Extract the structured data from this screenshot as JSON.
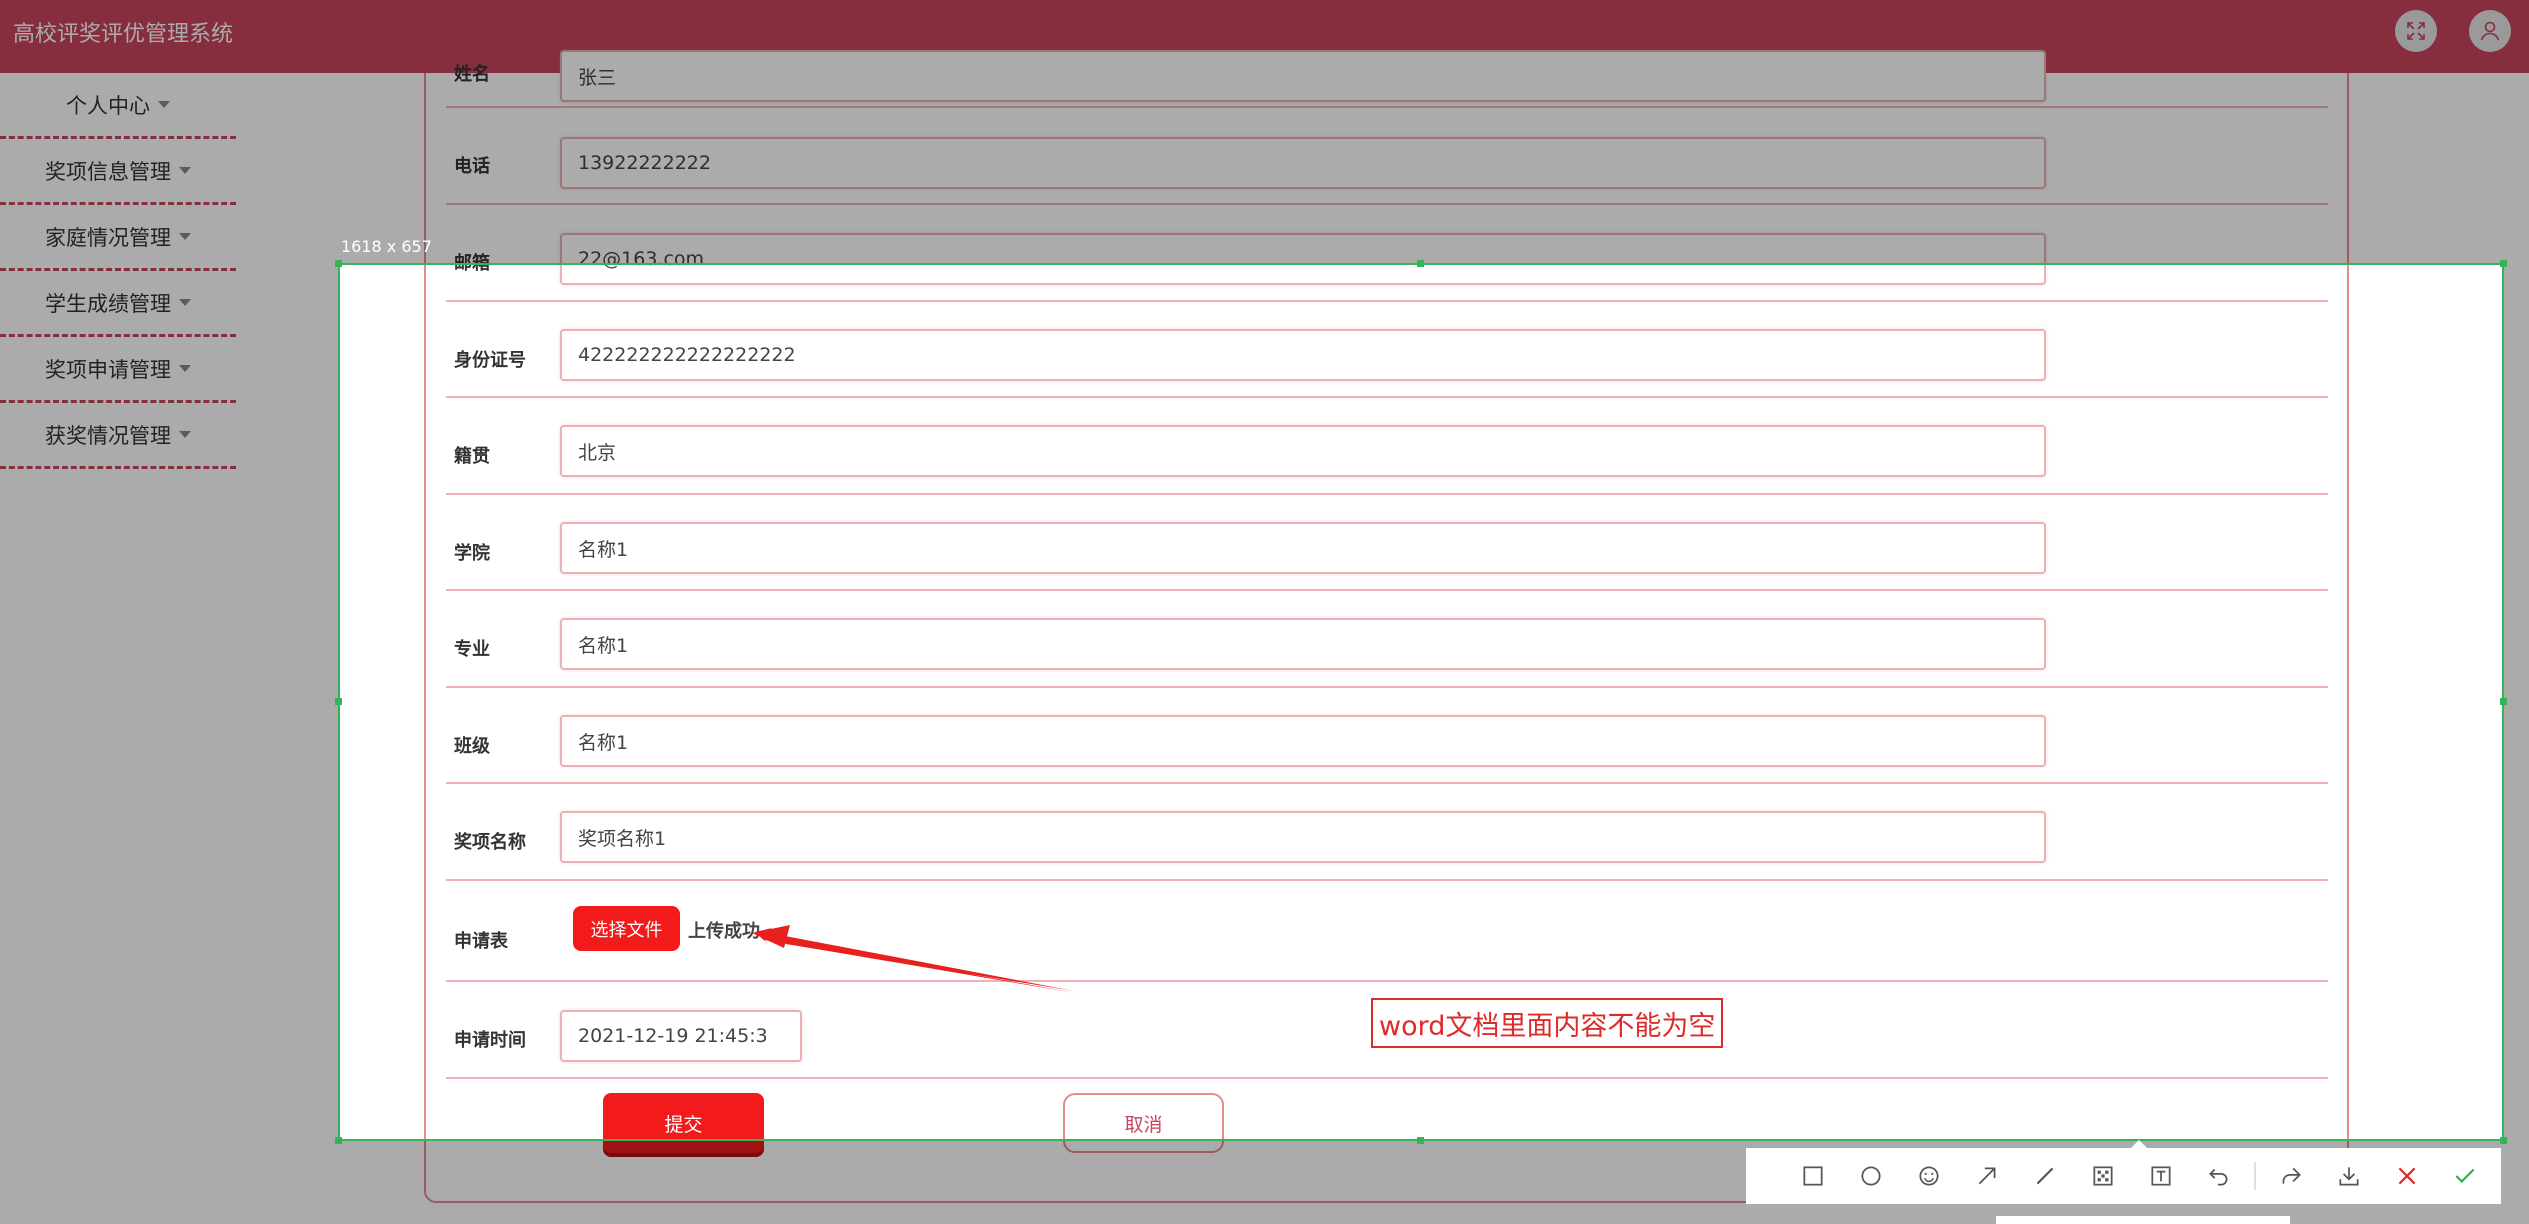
{
  "app": {
    "title": "高校评奖评优管理系统"
  },
  "header": {
    "fullscreen_icon": "fullscreen-icon",
    "user_icon": "user-icon"
  },
  "sidebar": {
    "items": [
      {
        "label": "个人中心"
      },
      {
        "label": "奖项信息管理"
      },
      {
        "label": "家庭情况管理"
      },
      {
        "label": "学生成绩管理"
      },
      {
        "label": "奖项申请管理"
      },
      {
        "label": "获奖情况管理"
      }
    ]
  },
  "form": {
    "top_partial": {
      "label": "姓名",
      "value": "张三"
    },
    "rows": [
      {
        "label": "电话",
        "value": "13922222222"
      },
      {
        "label": "邮箱",
        "value": "22@163.com"
      },
      {
        "label": "身份证号",
        "value": "422222222222222222"
      },
      {
        "label": "籍贯",
        "value": "北京"
      },
      {
        "label": "学院",
        "value": "名称1"
      },
      {
        "label": "专业",
        "value": "名称1"
      },
      {
        "label": "班级",
        "value": "名称1"
      },
      {
        "label": "奖项名称",
        "value": "奖项名称1"
      }
    ],
    "application": {
      "label": "申请表",
      "choose_file": "选择文件",
      "status": "上传成功"
    },
    "apply_time": {
      "label": "申请时间",
      "value": "2021-12-19 21:45:3"
    },
    "submit": "提交",
    "cancel": "取消"
  },
  "capture": {
    "size_label": "1618 x 657",
    "annotation": "word文档里面内容不能为空",
    "tools": [
      "rectangle-icon",
      "ellipse-icon",
      "emoji-icon",
      "arrow-icon",
      "line-icon",
      "mosaic-icon",
      "text-icon",
      "undo-icon",
      "share-icon",
      "download-icon",
      "close-icon",
      "confirm-icon"
    ]
  },
  "colors": {
    "brand": "#c8455d",
    "danger": "#f21a1a",
    "selection": "#35b35a"
  }
}
